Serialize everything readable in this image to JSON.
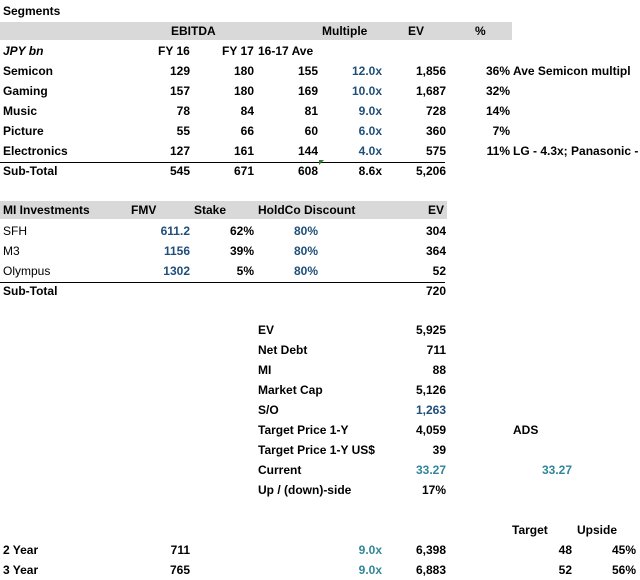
{
  "segments": {
    "title": "Segments",
    "header": {
      "ebitda": "EBITDA",
      "multiple": "Multiple",
      "ev": "EV",
      "pct": "%"
    },
    "subheader": {
      "unit": "JPY bn",
      "fy16": "FY 16",
      "fy17": "FY 17",
      "ave": "16-17 Ave"
    },
    "rows": [
      {
        "name": "Semicon",
        "fy16": "129",
        "fy17": "180",
        "ave": "155",
        "multiple": "12.0x",
        "ev": "1,856",
        "pct": "36%",
        "note": "Ave Semicon multipl"
      },
      {
        "name": "Gaming",
        "fy16": "157",
        "fy17": "180",
        "ave": "169",
        "multiple": "10.0x",
        "ev": "1,687",
        "pct": "32%",
        "note": ""
      },
      {
        "name": "Music",
        "fy16": "78",
        "fy17": "84",
        "ave": "81",
        "multiple": "9.0x",
        "ev": "728",
        "pct": "14%",
        "note": ""
      },
      {
        "name": "Picture",
        "fy16": "55",
        "fy17": "66",
        "ave": "60",
        "multiple": "6.0x",
        "ev": "360",
        "pct": "7%",
        "note": ""
      },
      {
        "name": "Electronics",
        "fy16": "127",
        "fy17": "161",
        "ave": "144",
        "multiple": "4.0x",
        "ev": "575",
        "pct": "11%",
        "note": "LG - 4.3x; Panasonic -"
      }
    ],
    "subtotal": {
      "name": "Sub-Total",
      "fy16": "545",
      "fy17": "671",
      "ave": "608",
      "multiple": "8.6x",
      "ev": "5,206"
    }
  },
  "mi": {
    "header": {
      "name": "MI Investments",
      "fmv": "FMV",
      "stake": "Stake",
      "discount": "HoldCo Discount",
      "ev": "EV"
    },
    "rows": [
      {
        "name": "SFH",
        "fmv": "611.2",
        "stake": "62%",
        "discount": "80%",
        "ev": "304"
      },
      {
        "name": "M3",
        "fmv": "1156",
        "stake": "39%",
        "discount": "80%",
        "ev": "364"
      },
      {
        "name": "Olympus",
        "fmv": "1302",
        "stake": "5%",
        "discount": "80%",
        "ev": "52"
      }
    ],
    "subtotal": {
      "name": "Sub-Total",
      "ev": "720"
    }
  },
  "valuation": {
    "rows": [
      {
        "label": "EV",
        "value": "5,925"
      },
      {
        "label": "Net Debt",
        "value": "711"
      },
      {
        "label": "MI",
        "value": "88"
      },
      {
        "label": "Market Cap",
        "value": "5,126"
      },
      {
        "label": "S/O",
        "value": "1,263"
      },
      {
        "label": "Target Price 1-Y",
        "value": "4,059"
      },
      {
        "label": "Target Price 1-Y US$",
        "value": "39"
      },
      {
        "label": "Current",
        "value": "33.27"
      },
      {
        "label": "Up / (down)-side",
        "value": "17%"
      }
    ],
    "ads_label": "ADS",
    "ads_current": "33.27"
  },
  "projection": {
    "header": {
      "target": "Target",
      "upside": "Upside"
    },
    "rows": [
      {
        "label": "2 Year",
        "ebitda": "711",
        "multiple": "9.0x",
        "ev": "6,398",
        "target": "48",
        "upside": "45%"
      },
      {
        "label": "3 Year",
        "ebitda": "765",
        "multiple": "9.0x",
        "ev": "6,883",
        "target": "52",
        "upside": "56%"
      }
    ]
  },
  "colors": {
    "header_band": "#d9d9d9",
    "input_blue": "#1f4e79",
    "link_teal": "#31869b",
    "comment_marker": "#2e7d32"
  }
}
